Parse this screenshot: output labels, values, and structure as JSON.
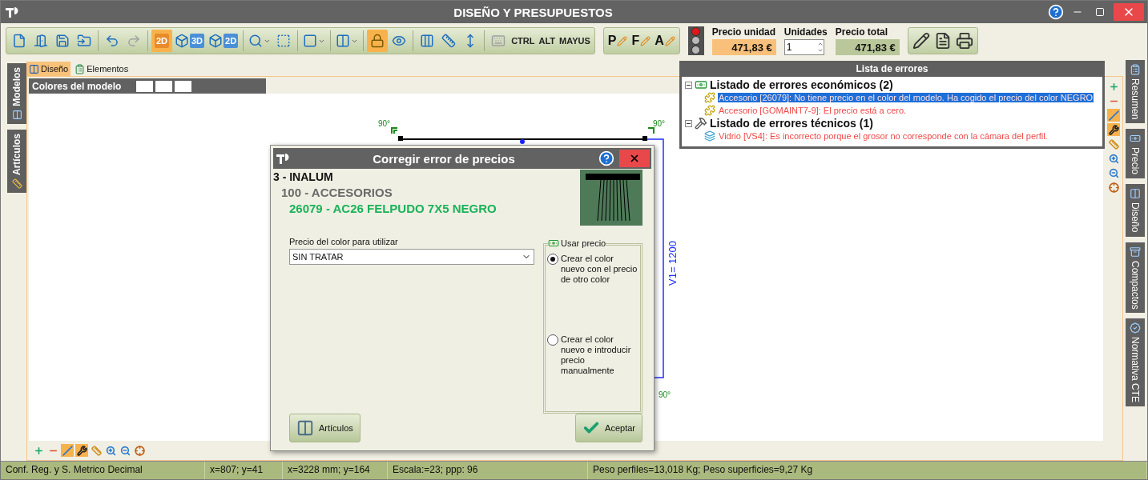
{
  "window": {
    "title": "DISEÑO Y PRESUPUESTOS"
  },
  "toolbar": {
    "tool_groups": [
      {
        "tools": [
          {
            "kind": "document",
            "selected": false,
            "disabled": false
          },
          {
            "kind": "component",
            "selected": false,
            "disabled": false
          },
          {
            "kind": "save",
            "selected": false,
            "disabled": false
          },
          {
            "kind": "export",
            "selected": false,
            "disabled": false
          }
        ]
      },
      {
        "tools": [
          {
            "kind": "undo",
            "selected": false,
            "disabled": false
          },
          {
            "kind": "redo",
            "selected": false,
            "disabled": true
          }
        ]
      },
      {
        "tools": [
          {
            "kind": "view",
            "label": "2D",
            "selected": true,
            "disabled": false
          },
          {
            "kind": "cube",
            "label": "3D",
            "selected": false,
            "disabled": false
          },
          {
            "kind": "cube",
            "label": "2D",
            "selected": false,
            "disabled": false
          }
        ]
      },
      {
        "tools": [
          {
            "kind": "zoom_menu",
            "selected": false,
            "disabled": false
          },
          {
            "kind": "select",
            "selected": false,
            "disabled": false
          }
        ]
      },
      {
        "tools": [
          {
            "kind": "shape_menu",
            "selected": false,
            "disabled": false
          }
        ]
      },
      {
        "tools": [
          {
            "kind": "panel_menu",
            "selected": false,
            "disabled": false
          }
        ]
      },
      {
        "tools": [
          {
            "kind": "lock",
            "selected": true,
            "disabled": false
          },
          {
            "kind": "eye",
            "selected": false,
            "disabled": false
          }
        ]
      },
      {
        "tools": [
          {
            "kind": "columns",
            "selected": false,
            "disabled": false
          },
          {
            "kind": "ruler",
            "selected": false,
            "disabled": false
          },
          {
            "kind": "dimension",
            "selected": false,
            "disabled": false
          }
        ]
      },
      {
        "tools": [
          {
            "kind": "keyboard",
            "selected": false,
            "disabled": true
          },
          {
            "kind": "key",
            "label": "CTRL",
            "selected": false,
            "disabled": false
          },
          {
            "kind": "key",
            "label": "ALT",
            "selected": false,
            "disabled": false
          },
          {
            "kind": "key",
            "label": "MAYUS",
            "selected": false,
            "disabled": false
          }
        ]
      }
    ],
    "report_buttons": [
      {
        "label": "P"
      },
      {
        "label": "F"
      },
      {
        "label": "A"
      }
    ],
    "status_lights": [
      {
        "on": true
      },
      {
        "on": false
      },
      {
        "on": false
      }
    ],
    "prices": {
      "unit": {
        "label": "Precio unidad",
        "value": "471,83 €"
      },
      "units": {
        "label": "Unidades",
        "value": "1"
      },
      "total": {
        "label": "Precio total",
        "value": "471,83 €"
      }
    },
    "actions": [
      {
        "kind": "edit_price"
      },
      {
        "kind": "document_edit"
      },
      {
        "kind": "print"
      }
    ]
  },
  "left_tabs": [
    {
      "label": "Modelos",
      "selected": false
    },
    {
      "label": "Artículos",
      "selected": false
    }
  ],
  "view_tabs": [
    {
      "label": "Diseño",
      "selected": true
    },
    {
      "label": "Elementos",
      "selected": false
    }
  ],
  "model_colors": {
    "title": "Colores del modelo",
    "swatches": [
      {
        "color": "#ffffff"
      },
      {
        "color": "#ffffff"
      },
      {
        "color": "#ffffff"
      }
    ]
  },
  "drawing": {
    "angles": [
      "90°",
      "90°",
      "90°"
    ],
    "dimension": "V1= 1200"
  },
  "side_tools": [
    {
      "kind": "add",
      "selected": false
    },
    {
      "kind": "remove",
      "selected": false
    },
    {
      "kind": "split",
      "selected": true
    },
    {
      "kind": "screw",
      "selected": true
    },
    {
      "kind": "ruler",
      "selected": false
    },
    {
      "kind": "zoom_in",
      "selected": false
    },
    {
      "kind": "zoom_out",
      "selected": false
    },
    {
      "kind": "target",
      "selected": false
    }
  ],
  "bottom_tools": [
    {
      "kind": "add",
      "selected": false
    },
    {
      "kind": "remove",
      "selected": false
    },
    {
      "kind": "split",
      "selected": true
    },
    {
      "kind": "screw",
      "selected": true
    },
    {
      "kind": "ruler",
      "selected": false
    },
    {
      "kind": "zoom_in",
      "selected": false
    },
    {
      "kind": "zoom_out",
      "selected": false
    },
    {
      "kind": "target",
      "selected": false
    }
  ],
  "right_tabs": [
    {
      "kind": "summary",
      "label": "Resumen",
      "selected": false
    },
    {
      "kind": "price",
      "label": "Precio",
      "selected": false
    },
    {
      "kind": "design",
      "label": "Diseño",
      "selected": false
    },
    {
      "kind": "compact",
      "label": "Compactos",
      "selected": false
    },
    {
      "kind": "norm",
      "label": "Normativa CTE",
      "selected": false
    }
  ],
  "error_list": {
    "title": "Lista de errores",
    "groups": [
      {
        "kind": "economic",
        "label": "Listado de errores económicos (2)",
        "expanded": true,
        "children": [
          {
            "kind": "accessory",
            "text": "Accesorio [26079]: No tiene precio en el color del modelo. Ha cogido el precio del color NEGRO",
            "selected": true
          },
          {
            "kind": "accessory",
            "text": "Accesorio [GOMAINT7-9]: El precio está a cero.",
            "selected": false
          }
        ]
      },
      {
        "kind": "technical",
        "label": "Listado de errores técnicos (1)",
        "expanded": true,
        "children": [
          {
            "kind": "glass",
            "text": "Vidrio [VS4]: Es incorrecto porque el grosor no corresponde con la cámara del perfil.",
            "selected": false
          }
        ]
      }
    ]
  },
  "dialog": {
    "title": "Corregir error de precios",
    "path": {
      "label": "3 - INALUM",
      "children": [
        {
          "label": "100 - ACCESORIOS",
          "children": [
            {
              "label": "26079 - AC26 FELPUDO 7X5 NEGRO"
            }
          ]
        }
      ]
    },
    "price_color": {
      "label": "Precio del color para utilizar",
      "value": "SIN TRATAR"
    },
    "use_price": {
      "title": "Usar precio",
      "options": [
        {
          "label": "Crear el color nuevo con el precio de otro color",
          "selected": true
        },
        {
          "label": "Crear el color nuevo e introducir precio manualmente",
          "selected": false
        }
      ]
    },
    "buttons": [
      {
        "kind": "articles",
        "label": "Artículos"
      },
      {
        "kind": "accept",
        "label": "Aceptar"
      }
    ]
  },
  "status_bar": [
    "Conf. Reg. y S. Metrico Decimal",
    "x=807; y=41",
    "x=3228 mm; y=164",
    "Escala:=23; ppp: 96",
    "Peso perfiles=13,018 Kg; Peso superficies=9,27 Kg"
  ]
}
